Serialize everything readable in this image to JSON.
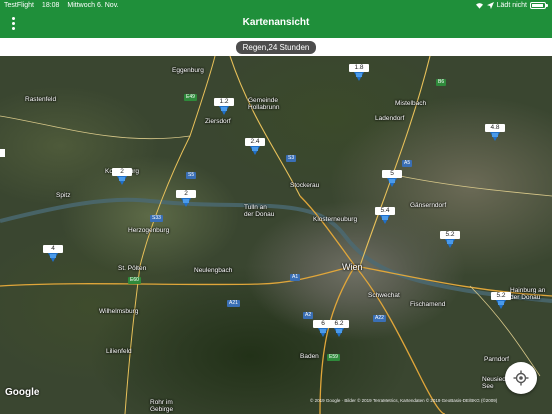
{
  "status": {
    "app": "TestFlight",
    "time": "18:08",
    "date": "Mittwoch 6. Nov.",
    "charging": "Lädt nicht"
  },
  "header": {
    "title": "Kartenansicht"
  },
  "filter": {
    "chip": "Regen,24 Stunden"
  },
  "map": {
    "google": "Google",
    "attribution": "© 2019 Google · Bilder © 2019 TerraMetrics, Kartendaten © 2019 GeoBasis-DE/BKG (©2009)",
    "places": [
      {
        "name": "Eggenburg",
        "key": "eggenburg"
      },
      {
        "name": "Gemeinde Hollabrunn",
        "key": "hollabrunn"
      },
      {
        "name": "Mistelbach",
        "key": "mistelbach"
      },
      {
        "name": "Rastenfeld",
        "key": "rastenfeld"
      },
      {
        "name": "Ziersdorf",
        "key": "ziersdorf"
      },
      {
        "name": "Ladendorf",
        "key": "ladendorf"
      },
      {
        "name": "Stockerau",
        "key": "stockerau"
      },
      {
        "name": "Tulln an der Donau",
        "key": "tulln"
      },
      {
        "name": "Korneuburg",
        "key": "korneuburg"
      },
      {
        "name": "Gänserndorf",
        "key": "gaenserndorf"
      },
      {
        "name": "Herzogenburg",
        "key": "herzogenburg"
      },
      {
        "name": "Klosterneuburg",
        "key": "klosterneuburg"
      },
      {
        "name": "St. Pölten",
        "key": "stpoelten"
      },
      {
        "name": "Neulengbach",
        "key": "neulengbach"
      },
      {
        "name": "Wien",
        "key": "wien"
      },
      {
        "name": "Schwechat",
        "key": "schwechat"
      },
      {
        "name": "Fischamend",
        "key": "fischamend"
      },
      {
        "name": "Wilhelmsburg",
        "key": "wilhelmsburg"
      },
      {
        "name": "Lilienfeld",
        "key": "lilienfeld"
      },
      {
        "name": "Baden",
        "key": "baden"
      },
      {
        "name": "Rohr im Gebirge",
        "key": "rohr"
      },
      {
        "name": "Parndorf",
        "key": "parndorf"
      },
      {
        "name": "Neusiedl am See",
        "key": "neusiedl"
      },
      {
        "name": "Hainburg an der Donau",
        "key": "hainburg"
      },
      {
        "name": "Spitz",
        "key": "spitz"
      }
    ],
    "markers": [
      {
        "value": "1.8"
      },
      {
        "value": "1.2"
      },
      {
        "value": "4.8"
      },
      {
        "value": "2.4"
      },
      {
        "value": "2"
      },
      {
        "value": "5"
      },
      {
        "value": "2"
      },
      {
        "value": "5.4"
      },
      {
        "value": "5.2"
      },
      {
        "value": "4"
      },
      {
        "value": "5.2"
      },
      {
        "value": "6"
      },
      {
        "value": "6.2"
      }
    ],
    "shields": [
      "E49",
      "S5",
      "S3",
      "A5",
      "A1",
      "S33",
      "A21",
      "E60",
      "A22",
      "A2",
      "E59",
      "B6"
    ]
  },
  "colors": {
    "header": "#1f8f3a",
    "pin": "#1f6fc8"
  },
  "icons": [
    "menu-dots-icon",
    "wifi-icon",
    "location-arrow-icon",
    "battery-icon",
    "locate-crosshair-icon"
  ]
}
